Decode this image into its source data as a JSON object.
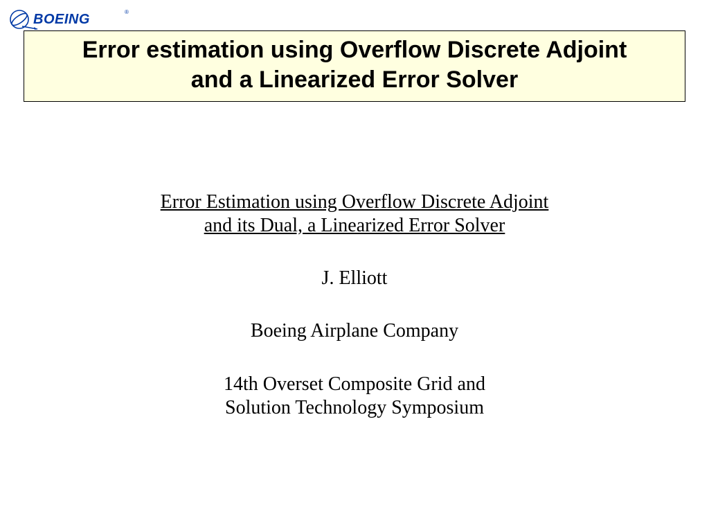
{
  "logo": {
    "brand": "BOEING",
    "registered": "®",
    "color": "#0039a6"
  },
  "title": {
    "line1": "Error estimation using Overflow Discrete Adjoint",
    "line2": "and a Linearized Error Solver"
  },
  "subtitle": {
    "line1": "Error Estimation using Overflow Discrete Adjoint",
    "line2": "and its Dual, a Linearized Error Solver"
  },
  "author": "J. Elliott",
  "company": "Boeing Airplane Company",
  "event": {
    "line1": "14th Overset Composite Grid and",
    "line2": "Solution Technology Symposium"
  }
}
